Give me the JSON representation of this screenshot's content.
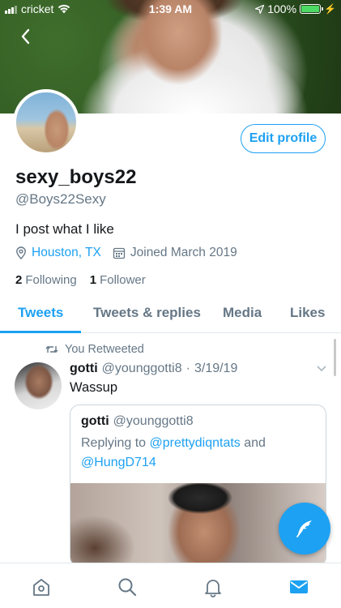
{
  "status_bar": {
    "carrier": "cricket",
    "time": "1:39 AM",
    "battery": "100%",
    "signal_bars": 3,
    "battery_level": 1.0
  },
  "profile": {
    "edit_button": "Edit profile",
    "display_name": "sexy_boys22",
    "handle": "@Boys22Sexy",
    "bio": "I post what I like",
    "location": "Houston, TX",
    "joined": "Joined March 2019",
    "following_count": "2",
    "following_label": "Following",
    "followers_count": "1",
    "followers_label": "Follower"
  },
  "tabs": [
    {
      "label": "Tweets",
      "active": true
    },
    {
      "label": "Tweets & replies",
      "active": false
    },
    {
      "label": "Media",
      "active": false
    },
    {
      "label": "Likes",
      "active": false
    }
  ],
  "tweet": {
    "retweet_label": "You Retweeted",
    "author_name": "gotti",
    "author_handle": "@younggotti8",
    "separator": "·",
    "date": "3/19/19",
    "text": "Wassup",
    "quote": {
      "author_name": "gotti",
      "author_handle": "@younggotti8",
      "reply_prefix": "Replying to",
      "reply_to_1": "@prettydiqntats",
      "reply_and": "and",
      "reply_to_2": "@HungD714"
    }
  },
  "colors": {
    "accent": "#1da1f2",
    "secondary_text": "#657786",
    "primary_text": "#14171a",
    "battery_green": "#4cd964"
  },
  "icons": {
    "back": "back-chevron-icon",
    "location": "location-pin-icon",
    "calendar": "calendar-icon",
    "retweet": "retweet-icon",
    "compose": "compose-feather-icon",
    "nav": [
      "home-icon",
      "search-icon",
      "notifications-bell-icon",
      "messages-envelope-icon"
    ]
  }
}
